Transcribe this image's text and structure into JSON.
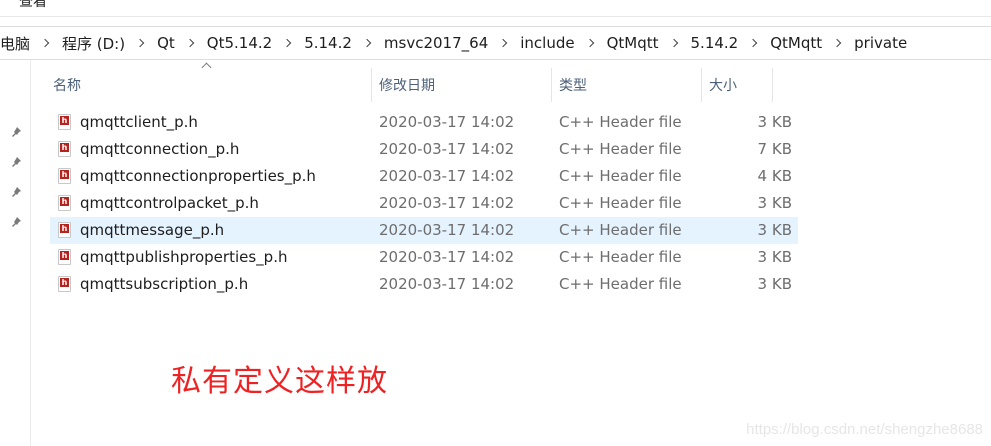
{
  "ribbon": {
    "tab_label": "查看"
  },
  "breadcrumb": [
    {
      "label": "电脑"
    },
    {
      "label": "程序 (D:)"
    },
    {
      "label": "Qt"
    },
    {
      "label": "Qt5.14.2"
    },
    {
      "label": "5.14.2"
    },
    {
      "label": "msvc2017_64"
    },
    {
      "label": "include"
    },
    {
      "label": "QtMqtt"
    },
    {
      "label": "5.14.2"
    },
    {
      "label": "QtMqtt"
    },
    {
      "label": "private"
    }
  ],
  "columns": {
    "name": "名称",
    "date": "修改日期",
    "type": "类型",
    "size": "大小"
  },
  "files": [
    {
      "name": "qmqttclient_p.h",
      "date": "2020-03-17 14:02",
      "type": "C++ Header file",
      "size": "3 KB",
      "selected": false
    },
    {
      "name": "qmqttconnection_p.h",
      "date": "2020-03-17 14:02",
      "type": "C++ Header file",
      "size": "7 KB",
      "selected": false
    },
    {
      "name": "qmqttconnectionproperties_p.h",
      "date": "2020-03-17 14:02",
      "type": "C++ Header file",
      "size": "4 KB",
      "selected": false
    },
    {
      "name": "qmqttcontrolpacket_p.h",
      "date": "2020-03-17 14:02",
      "type": "C++ Header file",
      "size": "3 KB",
      "selected": false
    },
    {
      "name": "qmqttmessage_p.h",
      "date": "2020-03-17 14:02",
      "type": "C++ Header file",
      "size": "3 KB",
      "selected": true
    },
    {
      "name": "qmqttpublishproperties_p.h",
      "date": "2020-03-17 14:02",
      "type": "C++ Header file",
      "size": "3 KB",
      "selected": false
    },
    {
      "name": "qmqttsubscription_p.h",
      "date": "2020-03-17 14:02",
      "type": "C++ Header file",
      "size": "3 KB",
      "selected": false
    }
  ],
  "file_icon_letter": "h",
  "annotation": "私有定义这样放",
  "watermark": "https://blog.csdn.net/shengzhe8688",
  "colors": {
    "selection": "#e5f3ff",
    "annotation": "#ee2222",
    "header_text": "#4c607a",
    "file_icon_badge": "#b5231f"
  }
}
